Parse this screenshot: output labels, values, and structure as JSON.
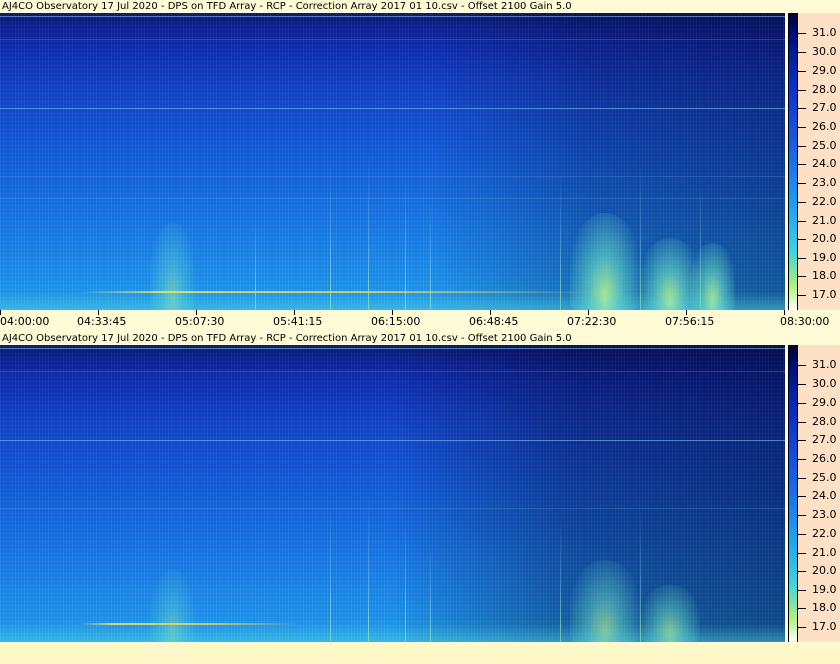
{
  "panels": [
    {
      "header": "AJ4CO Observatory 17 Jul 2020  -  DPS on TFD Array  -  RCP  -  Correction Array 2017 01 10.csv  -  Offset 2100  Gain 5.0",
      "freq_ticks": [
        "31.0",
        "30.0",
        "29.0",
        "28.0",
        "27.0",
        "26.0",
        "25.0",
        "24.0",
        "23.0",
        "22.0",
        "21.0",
        "20.0",
        "19.0",
        "18.0",
        "17.0"
      ],
      "time_ticks": [
        "04:00:00",
        "04:33:45",
        "05:07:30",
        "05:41:15",
        "06:15:00",
        "06:48:45",
        "07:22:30",
        "07:56:15",
        "08:30:00"
      ]
    },
    {
      "header": "AJ4CO Observatory 17 Jul 2020  -  DPS on TFD Array  -  RCP  -  Correction Array 2017 01 10.csv  -  Offset 2100  Gain 5.0",
      "freq_ticks": [
        "31.0",
        "30.0",
        "29.0",
        "28.0",
        "27.0",
        "26.0",
        "25.0",
        "24.0",
        "23.0",
        "22.0",
        "21.0",
        "20.0",
        "19.0",
        "18.0",
        "17.0"
      ],
      "time_ticks": []
    }
  ],
  "colors": {
    "background": "#fffbd6",
    "axis_bg": "#fde0c6",
    "spectrogram_dark": "#0a1a6a",
    "spectrogram_mid": "#1462e2",
    "spectrogram_light": "#26a6ef",
    "burst": "#c8ff8c"
  }
}
